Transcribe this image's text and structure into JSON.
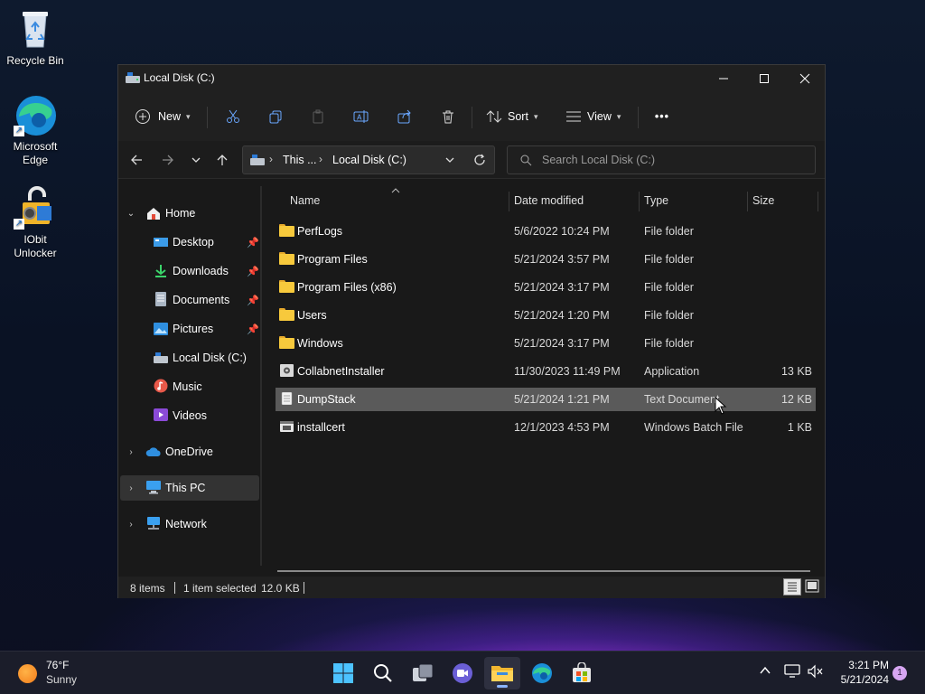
{
  "desktop": {
    "icons": [
      {
        "label": "Recycle Bin"
      },
      {
        "label_line1": "Microsoft",
        "label_line2": "Edge"
      },
      {
        "label_line1": "IObit",
        "label_line2": "Unlocker"
      }
    ]
  },
  "window": {
    "title": "Local Disk (C:)",
    "toolbar": {
      "new_label": "New",
      "sort_label": "Sort",
      "view_label": "View",
      "more_label": "•••"
    },
    "address": {
      "seg1": "This ...",
      "sep": "›",
      "seg2": "Local Disk (C:)"
    },
    "search": {
      "placeholder": "Search Local Disk (C:)"
    },
    "nav": {
      "home": "Home",
      "desktop": "Desktop",
      "downloads": "Downloads",
      "documents": "Documents",
      "pictures": "Pictures",
      "localdisk": "Local Disk (C:)",
      "music": "Music",
      "videos": "Videos",
      "onedrive": "OneDrive",
      "thispc": "This PC",
      "network": "Network"
    },
    "columns": {
      "name": "Name",
      "date": "Date modified",
      "type": "Type",
      "size": "Size"
    },
    "files": [
      {
        "name": "PerfLogs",
        "date": "5/6/2022 10:24 PM",
        "type": "File folder",
        "size": ""
      },
      {
        "name": "Program Files",
        "date": "5/21/2024 3:57 PM",
        "type": "File folder",
        "size": ""
      },
      {
        "name": "Program Files (x86)",
        "date": "5/21/2024 3:17 PM",
        "type": "File folder",
        "size": ""
      },
      {
        "name": "Users",
        "date": "5/21/2024 1:20 PM",
        "type": "File folder",
        "size": ""
      },
      {
        "name": "Windows",
        "date": "5/21/2024 3:17 PM",
        "type": "File folder",
        "size": ""
      },
      {
        "name": "CollabnetInstaller",
        "date": "11/30/2023 11:49 PM",
        "type": "Application",
        "size": "13 KB"
      },
      {
        "name": "DumpStack",
        "date": "5/21/2024 1:21 PM",
        "type": "Text Document",
        "size": "12 KB"
      },
      {
        "name": "installcert",
        "date": "12/1/2023 4:53 PM",
        "type": "Windows Batch File",
        "size": "1 KB"
      }
    ],
    "status": {
      "items": "8 items",
      "selected": "1 item selected",
      "size": "12.0 KB"
    }
  },
  "taskbar": {
    "weather_temp": "76°F",
    "weather_desc": "Sunny",
    "time": "3:21 PM",
    "date": "5/21/2024",
    "notification_count": "1"
  },
  "colors": {
    "accent": "#8ab4ff",
    "folder": "#f7c93c",
    "selection": "#5a5a5a"
  }
}
